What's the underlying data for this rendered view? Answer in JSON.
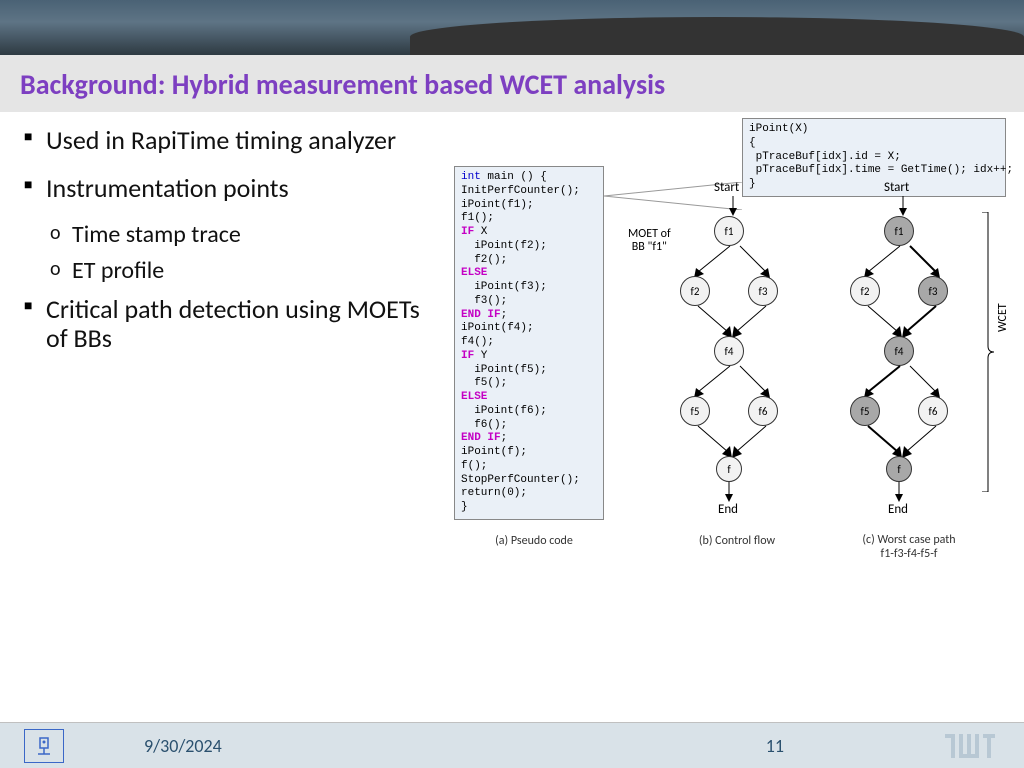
{
  "title": "Background: Hybrid measurement based WCET analysis",
  "bullets": {
    "b1": "Used in RapiTime timing analyzer",
    "b2": "Instrumentation points",
    "b2a": "Time stamp trace",
    "b2b": "ET profile",
    "b3": "Critical path detection using MOETs of BBs"
  },
  "code": {
    "ipoint": "iPoint(X)\n{\n pTraceBuf[idx].id = X;\n pTraceBuf[idx].time = GetTime(); idx++;\n}",
    "main_open": "int",
    "main_rest": " main () {\nInitPerfCounter();\niPoint(f1);\nf1();",
    "if1": "IF",
    "if1_cond": " X",
    "if1_body": "  iPoint(f2);\n  f2();",
    "else1": "ELSE",
    "else1_body": "  iPoint(f3);\n  f3();",
    "endif1": "END IF",
    "mid": "iPoint(f4);\nf4();",
    "if2": "IF",
    "if2_cond": " Y",
    "if2_body": "  iPoint(f5);\n  f5();",
    "else2": "ELSE",
    "else2_body": "  iPoint(f6);\n  f6();",
    "endif2": "END IF",
    "tail": "iPoint(f);\nf();\nStopPerfCounter();\nreturn(0);\n}",
    "semi": ";"
  },
  "graph": {
    "start": "Start",
    "end": "End",
    "f1": "f1",
    "f2": "f2",
    "f3": "f3",
    "f4": "f4",
    "f5": "f5",
    "f6": "f6",
    "f": "f",
    "moet": "MOET of\nBB \"f1\"",
    "wcet": "WCET"
  },
  "captions": {
    "a": "(a) Pseudo code",
    "b": "(b) Control flow",
    "c": "(c) Worst case path\nf1-f3-f4-f5-f"
  },
  "footer": {
    "date": "9/30/2024",
    "page": "11"
  }
}
